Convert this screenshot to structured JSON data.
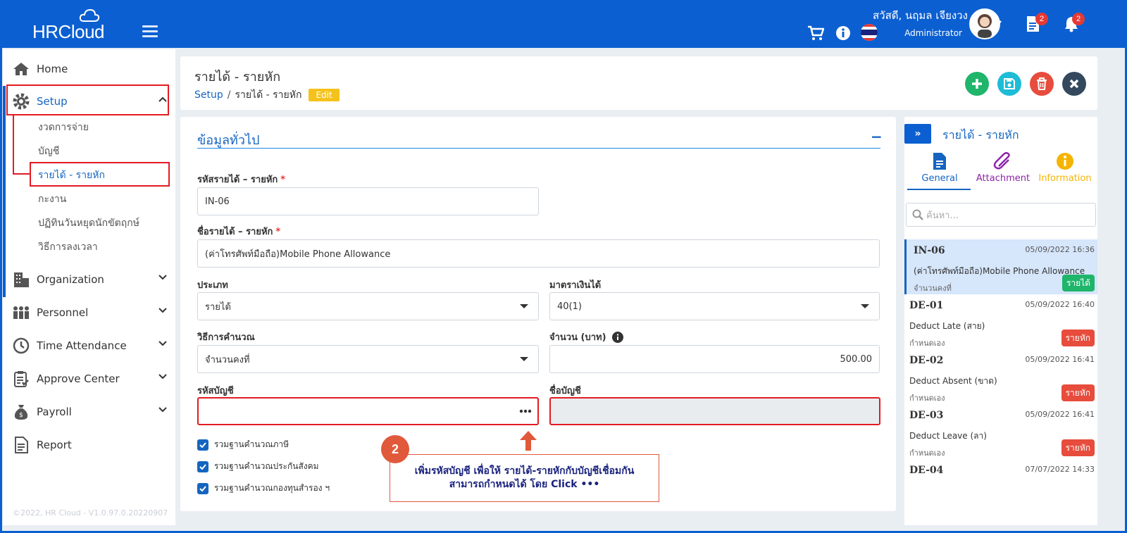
{
  "app": {
    "logo_text": "HRCloud"
  },
  "header": {
    "greeting": "สวัสดี, นฤมล เจียงวง",
    "role": "Administrator",
    "doc_badge": "2",
    "bell_badge": "2"
  },
  "sidebar": {
    "home": "Home",
    "setup": "Setup",
    "setup_items": [
      "งวดการจ่าย",
      "บัญชี",
      "รายได้ - รายหัก",
      "กะงาน",
      "ปฏิทินวันหยุดนักขัตฤกษ์",
      "วิธีการลงเวลา"
    ],
    "organization": "Organization",
    "personnel": "Personnel",
    "time_attendance": "Time Attendance",
    "approve_center": "Approve Center",
    "payroll": "Payroll",
    "report": "Report",
    "copyright": "©2022, HR Cloud - V1.0.97.0.20220907"
  },
  "page": {
    "title": "รายได้ - รายหัก",
    "breadcrumb_root": "Setup",
    "breadcrumb_sep": "/",
    "breadcrumb_current": "รายได้ - รายหัก",
    "mode_badge": "Edit"
  },
  "form": {
    "section_title": "ข้อมูลทั่วไป",
    "collapse_symbol": "−",
    "code_label": "รหัสรายได้ – รายหัก",
    "code_value": "IN-06",
    "name_label": "ชื่อรายได้ – รายหัก",
    "name_value": "(ค่าโทรศัพท์มือถือ)Mobile Phone Allowance",
    "type_label": "ประเภท",
    "type_value": "รายได้",
    "section_label": "มาตราเงินได้",
    "section_value": "40(1)",
    "calc_label": "วิธีการคำนวณ",
    "calc_value": "จำนวนคงที่",
    "amount_label": "จำนวน (บาท)",
    "amount_value": "500.00",
    "acct_code_label": "รหัสบัญชี",
    "acct_code_value": "",
    "acct_name_label": "ชื่อบัญชี",
    "acct_name_value": "",
    "checkboxes": [
      "รวมฐานคำนวณภาษี",
      "รวมฐานคำนวณประกันสังคม",
      "รวมฐานคำนวณกองทุนสำรอง ฯ"
    ]
  },
  "annotation": {
    "number": "2",
    "line1": "เพิ่มรหัสบัญชี เพื่อให้ รายได้-รายหักกับบัญชีเชื่อมกัน",
    "line2": "สามารถกำหนดได้ โดย Click •••"
  },
  "right_panel": {
    "title": "รายได้ - รายหัก",
    "tabs": [
      "General",
      "Attachment",
      "Information"
    ],
    "search_placeholder": "ค้นหา...",
    "items": [
      {
        "code": "IN-06",
        "date": "05/09/2022 16:36",
        "name": "(ค่าโทรศัพท์มือถือ)Mobile Phone Allowance",
        "mode": "จำนวนคงที่",
        "tag": "รายได้"
      },
      {
        "code": "DE-01",
        "date": "05/09/2022 16:40",
        "name": "Deduct Late (สาย)",
        "mode": "กำหนดเอง",
        "tag": "รายหัก"
      },
      {
        "code": "DE-02",
        "date": "05/09/2022 16:41",
        "name": "Deduct Absent (ขาด)",
        "mode": "กำหนดเอง",
        "tag": "รายหัก"
      },
      {
        "code": "DE-03",
        "date": "05/09/2022 16:41",
        "name": "Deduct Leave (ลา)",
        "mode": "กำหนดเอง",
        "tag": "รายหัก"
      },
      {
        "code": "DE-04",
        "date": "07/07/2022 14:33",
        "name": "",
        "mode": "",
        "tag": ""
      }
    ]
  },
  "colors": {
    "brand": "#0b5fd1",
    "income": "#1fb56b",
    "deduct": "#e74c3c",
    "highlight": "#e31b23"
  }
}
